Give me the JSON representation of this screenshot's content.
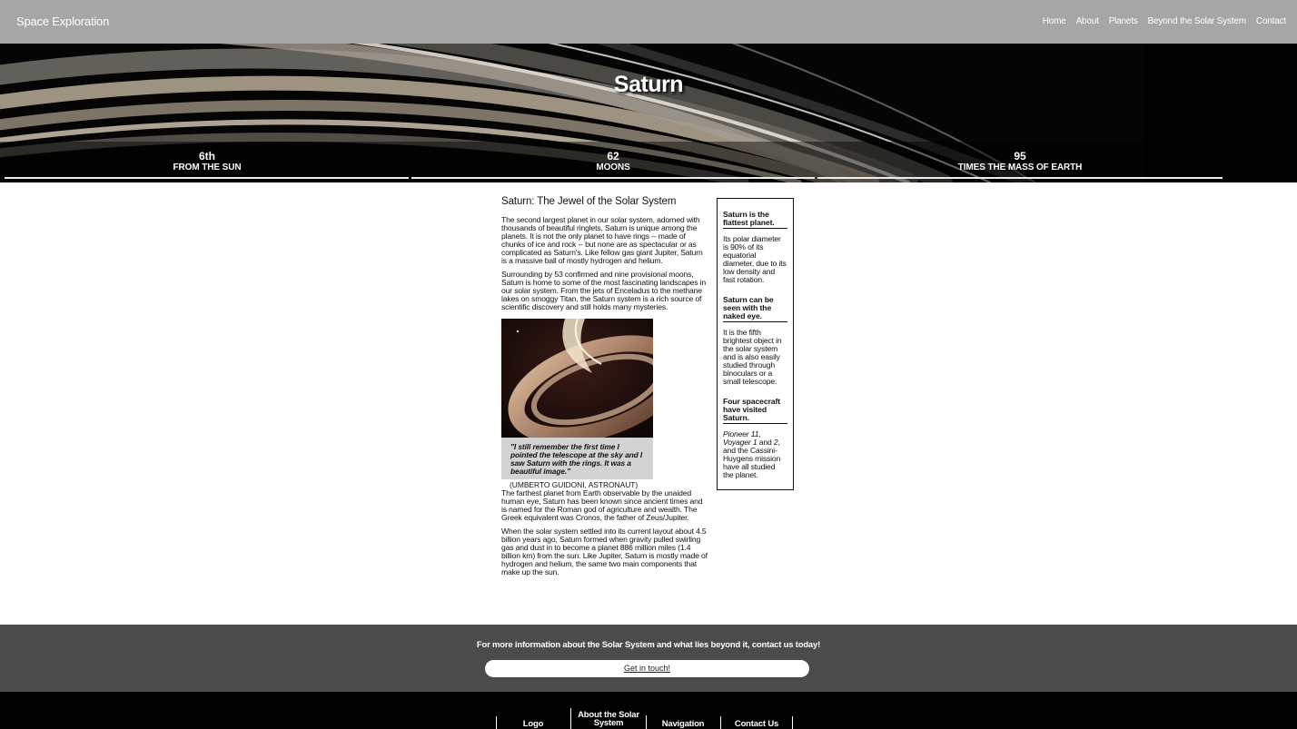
{
  "header": {
    "brand": "Space Exploration",
    "nav": [
      "Home",
      "About",
      "Planets",
      "Beyond the Solar System",
      "Contact"
    ]
  },
  "hero": {
    "title": "Saturn",
    "stats": [
      {
        "value": "6th",
        "label": "FROM THE SUN"
      },
      {
        "value": "62",
        "label": "MOONS"
      },
      {
        "value": "95",
        "label": "TIMES THE MASS OF EARTH"
      }
    ]
  },
  "main": {
    "heading": "Saturn: The Jewel of the Solar System",
    "paragraphs": [
      "The second largest planet in our solar system, adorned with thousands of beautiful ringlets, Saturn is unique among the planets. It is not the only planet to have rings -- made of chunks of ice and rock -- but none are as spectacular or as complicated as Saturn's. Like fellow gas giant Jupiter, Saturn is a massive ball of mostly hydrogen and helium.",
      "Surrounding by 53 confirmed and nine provisional moons, Saturn is home to some of the most fascinating landscapes in our solar system. From the jets of Enceladus to the methane lakes on smoggy Titan, the Saturn system is a rich source of scientific discovery and still holds many mysteries."
    ],
    "quote": "\"I still remember the first time I pointed the telescope at the sky and I saw Saturn with the rings. It was a beautiful image.\"",
    "quote_cite": "(UMBERTO GUIDONI, ASTRONAUT)",
    "paragraphs_after": [
      "The farthest planet from Earth observable by the unaided human eye, Saturn has been known since ancient times and is named for the Roman god of agriculture and wealth. The Greek equivalent was Cronos, the father of Zeus/Jupiter.",
      "When the solar system settled into its current layout about 4.5 billion years ago, Saturn formed when gravity pulled swirling gas and dust in to become a planet 886 million miles (1.4 billion km) from the sun. Like Jupiter, Saturn is mostly made of hydrogen and helium, the same two main components that make up the sun."
    ]
  },
  "aside": {
    "facts": [
      {
        "title": "Saturn is the flattest planet.",
        "body": "Its polar diameter is 90% of its equatorial diameter, due to its low density and fast rotation."
      },
      {
        "title": "Saturn can be seen with the naked eye.",
        "body": "It is the fifth brightest object in the solar system and is also easily studied through binoculars or a small telescope."
      }
    ],
    "fact3_title": "Four spacecraft have visited Saturn.",
    "fact3_body_parts": [
      "Pioneer 11",
      ", ",
      "Voyager 1",
      " and ",
      "2",
      ", and the Cassini-Huygens mission have all studied the planet."
    ]
  },
  "cta": {
    "text": "For more information about the Solar System and what lies beyond it, contact us today!",
    "button": "Get in touch!"
  },
  "footer": {
    "items": [
      "Logo",
      "About the Solar System",
      "Navigation",
      "Contact Us"
    ]
  }
}
